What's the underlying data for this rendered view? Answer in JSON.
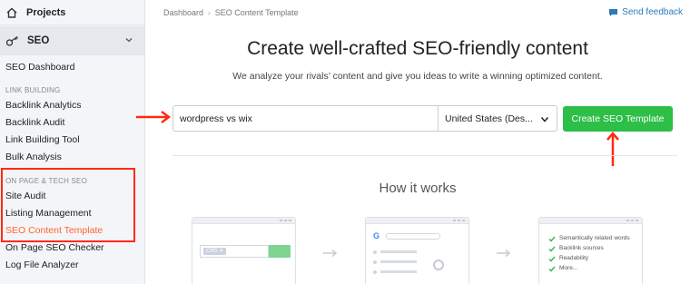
{
  "sidebar": {
    "projects_label": "Projects",
    "seo_label": "SEO",
    "dashboard_label": "SEO Dashboard",
    "link_building_section": "LINK BUILDING",
    "backlink_analytics": "Backlink Analytics",
    "backlink_audit": "Backlink Audit",
    "link_building_tool": "Link Building Tool",
    "bulk_analysis": "Bulk Analysis",
    "on_page_section": "ON PAGE & TECH SEO",
    "site_audit": "Site Audit",
    "listing_management": "Listing Management",
    "seo_content_template": "SEO Content Template",
    "on_page_checker": "On Page SEO Checker",
    "log_file_analyzer": "Log File Analyzer"
  },
  "breadcrumb": {
    "home": "Dashboard",
    "separator": "›",
    "current": "SEO Content Template"
  },
  "header": {
    "feedback_label": "Send feedback"
  },
  "main": {
    "title": "Create well-crafted SEO-friendly content",
    "subtitle": "We analyze your rivals’ content and give you ideas to write a winning optimized content.",
    "keyword_value": "wordpress vs wix",
    "region_value": "United States (Des...",
    "cta_label": "Create SEO Template",
    "how_title": "How it works",
    "card1_tag": "CRS ✕",
    "card3_items": [
      "Semantically related words",
      "Backlink sources",
      "Readability",
      "More..."
    ]
  },
  "colors": {
    "accent_orange": "#ff642d",
    "annotation_red": "#ff2a12",
    "cta_green": "#2dbf48",
    "link_blue": "#2e7ab8"
  },
  "icons": {
    "projects": "home-icon",
    "seo": "key-icon",
    "feedback": "chat-bubble-icon",
    "dropdown": "chevron-down-icon"
  }
}
